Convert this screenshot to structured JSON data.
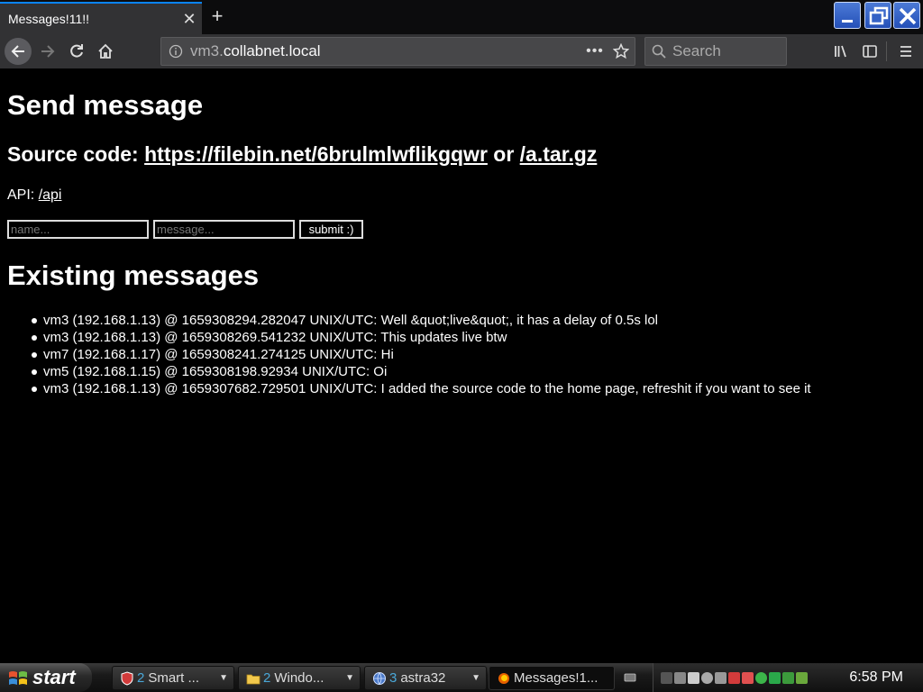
{
  "browser": {
    "tab_title": "Messages!11!!",
    "tab_close": "✕",
    "new_tab": "+",
    "url_host_prefix": "vm3.",
    "url_host_domain": "collabnet.local",
    "url_more": "•••",
    "search_placeholder": "Search"
  },
  "page": {
    "heading_send": "Send message",
    "source_prefix": "Source code: ",
    "source_link": "https://filebin.net/6brulmlwflikgqwr",
    "source_or": " or ",
    "source_tar": "/a.tar.gz",
    "api_prefix": "API: ",
    "api_link": "/api",
    "name_placeholder": "name...",
    "message_placeholder": "message...",
    "submit_label": "submit :)",
    "heading_existing": "Existing messages",
    "messages": [
      "vm3 (192.168.1.13) @ 1659308294.282047 UNIX/UTC: Well &quot;live&quot;, it has a delay of 0.5s lol",
      "vm3 (192.168.1.13) @ 1659308269.541232 UNIX/UTC: This updates live btw",
      "vm7 (192.168.1.17) @ 1659308241.274125 UNIX/UTC: Hi",
      "vm5 (192.168.1.15) @ 1659308198.92934 UNIX/UTC: Oi",
      "vm3 (192.168.1.13) @ 1659307682.729501 UNIX/UTC: I added the source code to the home page, refreshit if you want to see it"
    ]
  },
  "taskbar": {
    "start_label": "start",
    "tasks": [
      {
        "count": "2",
        "label": "Smart ..."
      },
      {
        "count": "2",
        "label": "Windo..."
      },
      {
        "count": "3",
        "label": "astra32"
      },
      {
        "count": "",
        "label": "Messages!1..."
      }
    ],
    "clock": "6:58 PM"
  }
}
